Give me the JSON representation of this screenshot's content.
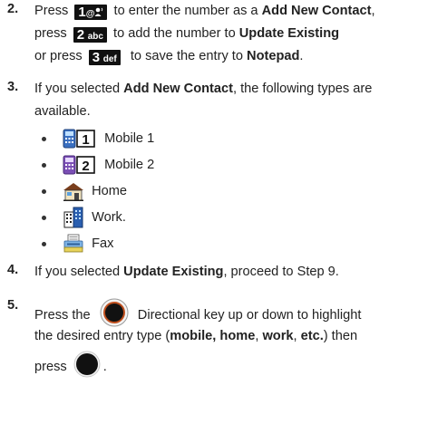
{
  "step2": {
    "number": "2.",
    "l1_pre": "Press",
    "key1_digit": "1",
    "key1_sub": "@",
    "l1_post": "to enter the number as a",
    "l1_bold": "Add New Contact",
    "l1_end": ",",
    "l2_pre": "press",
    "key2_digit": "2",
    "key2_sub": "abc",
    "l2_post": "to add the number to",
    "l2_bold": "Update Existing",
    "l3_pre": "or press",
    "key3_digit": "3",
    "key3_sub": "def",
    "l3_post": "to save the entry to",
    "l3_bold": "Notepad",
    "l3_end": "."
  },
  "step3": {
    "number": "3.",
    "l1_pre": "If you selected",
    "l1_bold": "Add New Contact",
    "l1_post": ", the following types are",
    "l2": "available.",
    "types": [
      {
        "label": "Mobile 1",
        "icon": "mobile-1-icon"
      },
      {
        "label": "Mobile 2",
        "icon": "mobile-2-icon"
      },
      {
        "label": "Home",
        "icon": "home-icon"
      },
      {
        "label": "Work.",
        "icon": "work-icon"
      },
      {
        "label": "Fax",
        "icon": "fax-icon"
      }
    ]
  },
  "step4": {
    "number": "4.",
    "pre": "If you selected",
    "bold": "Update Existing",
    "post": ", proceed to Step 9."
  },
  "step5": {
    "number": "5.",
    "l1_pre": "Press the",
    "l1_post": "Directional key up or down to highlight",
    "l2_pre": "the desired entry type (",
    "l2_bold1": "mobile, home",
    "l2_sep1": ", ",
    "l2_bold2": "work",
    "l2_sep2": ", ",
    "l2_bold3": "etc.",
    "l2_post": ") then",
    "l3_pre": "press",
    "l3_end": "."
  },
  "colors": {
    "text": "#222222",
    "key_bg": "#111111",
    "nav_ring": "#c0501f"
  }
}
